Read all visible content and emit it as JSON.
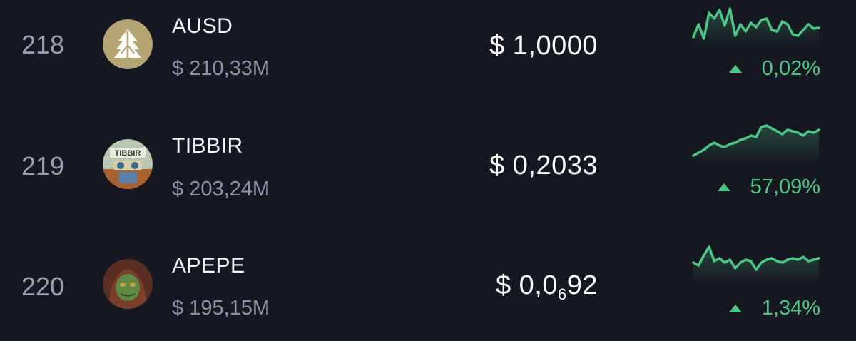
{
  "colors": {
    "background": "#161821",
    "positive": "#4cc684",
    "muted_text": "#8e91a6",
    "primary_text": "#f4f5f8"
  },
  "rows": [
    {
      "rank": "218",
      "name": "AUSD",
      "market_cap": "$ 210,33M",
      "price": "$ 1,0000",
      "change": "0,02%",
      "direction": "up",
      "icon": "ausd-logo-icon",
      "sparkline": [
        48,
        30,
        50,
        14,
        22,
        10,
        32,
        8,
        46,
        30,
        40,
        28,
        34,
        24,
        22,
        38,
        40,
        26,
        30,
        44,
        46,
        38,
        30,
        36,
        35
      ]
    },
    {
      "rank": "219",
      "name": "TIBBIR",
      "market_cap": "$ 203,24M",
      "price": "$ 0,2033",
      "change": "57,09%",
      "direction": "up",
      "icon": "tibbir-avatar-icon",
      "sparkline": [
        48,
        44,
        40,
        34,
        30,
        34,
        36,
        32,
        30,
        26,
        24,
        20,
        22,
        8,
        6,
        10,
        14,
        18,
        12,
        14,
        16,
        20,
        14,
        16,
        12
      ]
    },
    {
      "rank": "220",
      "name": "APEPE",
      "market_cap": "$ 195,15M",
      "price_prefix": "$ 0,0",
      "price_zeros": "6",
      "price_suffix": "92",
      "change": "1,34%",
      "direction": "up",
      "icon": "apepe-avatar-icon",
      "sparkline": [
        30,
        34,
        20,
        8,
        28,
        24,
        30,
        26,
        38,
        30,
        26,
        28,
        40,
        30,
        26,
        24,
        28,
        30,
        26,
        24,
        26,
        22,
        28,
        26,
        24
      ]
    }
  ]
}
